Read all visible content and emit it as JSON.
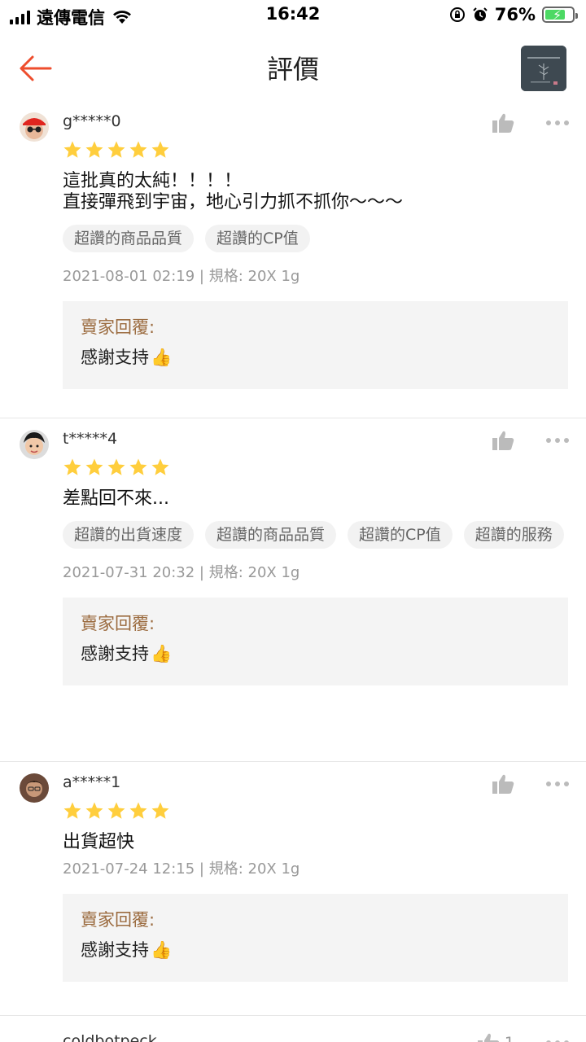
{
  "status_bar": {
    "carrier": "遠傳電信",
    "time": "16:42",
    "battery": "76%"
  },
  "header": {
    "title": "評價",
    "back_icon": "back-arrow-icon"
  },
  "reviews": [
    {
      "username": "g*****0",
      "rating": 5,
      "comment": "這批真的太純！！！！\n直接彈飛到宇宙，地心引力抓不抓你～～～",
      "tags": [
        "超讚的商品品質",
        "超讚的CP值"
      ],
      "meta": "2021-08-01 02:19 | 規格: 20X 1g",
      "reply_label": "賣家回覆:",
      "reply_text": "感謝支持"
    },
    {
      "username": "t*****4",
      "rating": 5,
      "comment": "差點回不來...",
      "tags": [
        "超讚的出貨速度",
        "超讚的商品品質",
        "超讚的CP值",
        "超讚的服務"
      ],
      "meta": "2021-07-31 20:32 | 規格: 20X 1g",
      "reply_label": "賣家回覆:",
      "reply_text": "感謝支持"
    },
    {
      "username": "a*****1",
      "rating": 5,
      "comment": "出貨超快",
      "tags": [],
      "meta": "2021-07-24 12:15 | 規格: 20X 1g",
      "reply_label": "賣家回覆:",
      "reply_text": "感謝支持"
    }
  ],
  "partial_review": {
    "username": "coldbotpeck",
    "like_count": "1"
  },
  "colors": {
    "accent": "#ee4d2d",
    "star": "#ffce3d",
    "reply_label": "#9b6b3f"
  }
}
